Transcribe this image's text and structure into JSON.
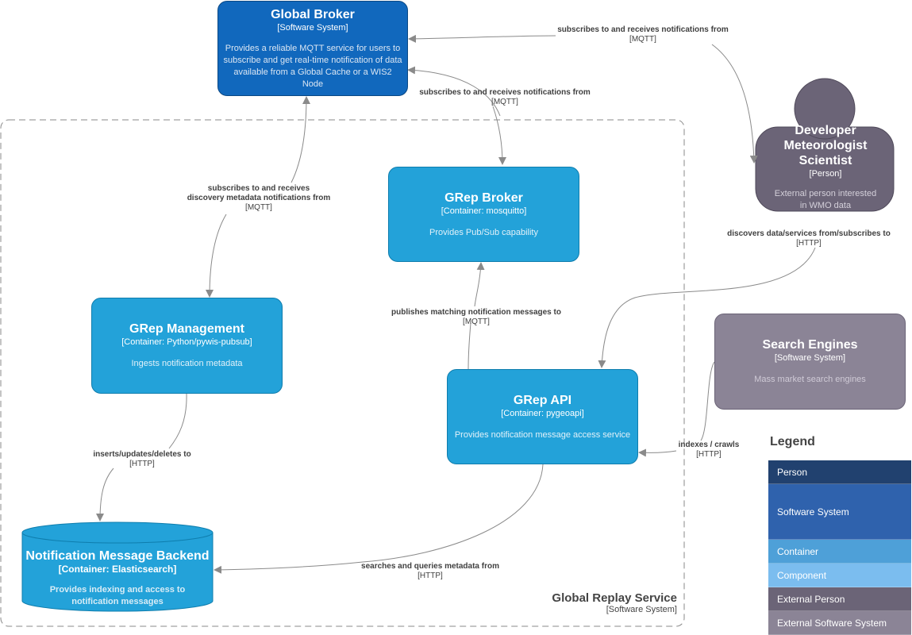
{
  "nodes": {
    "global_broker": {
      "title": "Global Broker",
      "type": "[Software System]",
      "description": "Provides a reliable MQTT service for users to subscribe and get real-time notification of data available from a Global Cache or a WIS2 Node"
    },
    "person": {
      "title": "Developer Meteorologist Scientist",
      "type": "[Person]",
      "description": "External person interested in WMO data"
    },
    "grep_broker": {
      "title": "GRep Broker",
      "type": "[Container: mosquitto]",
      "description": "Provides Pub/Sub capability"
    },
    "grep_management": {
      "title": "GRep Management",
      "type": "[Container: Python/pywis-pubsub]",
      "description": "Ingests notification metadata"
    },
    "grep_api": {
      "title": "GRep API",
      "type": "[Container: pygeoapi]",
      "description": "Provides notification message access service"
    },
    "search_engines": {
      "title": "Search Engines",
      "type": "[Software System]",
      "description": "Mass market search engines"
    },
    "backend": {
      "title": "Notification Message Backend",
      "type": "[Container: Elasticsearch]",
      "description": "Provides indexing and access to notification messages"
    }
  },
  "boundary": {
    "title": "Global Replay Service",
    "type": "[Software System]"
  },
  "edges": [
    {
      "label": "subscribes to and receives notifications from",
      "tech": "[MQTT]"
    },
    {
      "label": "subscribes to and receives notifications from",
      "tech": "[MQTT]"
    },
    {
      "label": "subscribes to and receives discovery metadata notifications from",
      "label_line1": "subscribes to and receives",
      "label_line2": "discovery metadata notifications from",
      "tech": "[MQTT]"
    },
    {
      "label": "publishes matching notification messages to",
      "tech": "[MQTT]"
    },
    {
      "label": "discovers data/services from/subscribes to",
      "tech": "[HTTP]"
    },
    {
      "label": "indexes / crawls",
      "tech": "[HTTP]"
    },
    {
      "label": "inserts/updates/deletes to",
      "tech": "[HTTP]"
    },
    {
      "label": "searches and queries metadata from",
      "tech": "[HTTP]"
    }
  ],
  "legend": {
    "title": "Legend",
    "items": [
      {
        "label": "Person",
        "color": "#21416f"
      },
      {
        "label": "Software System",
        "color": "#2f62ad"
      },
      {
        "label": "Container",
        "color": "#4ea0d8"
      },
      {
        "label": "Component",
        "color": "#7bbdef"
      },
      {
        "label": "External Person",
        "color": "#6b6477"
      },
      {
        "label": "External Software System",
        "color": "#8b8496"
      }
    ]
  },
  "colors": {
    "software_system": "#1168bd",
    "container": "#23a2d9",
    "external_person": "#6b6477",
    "external_system": "#8b8496",
    "edge": "#707070"
  }
}
